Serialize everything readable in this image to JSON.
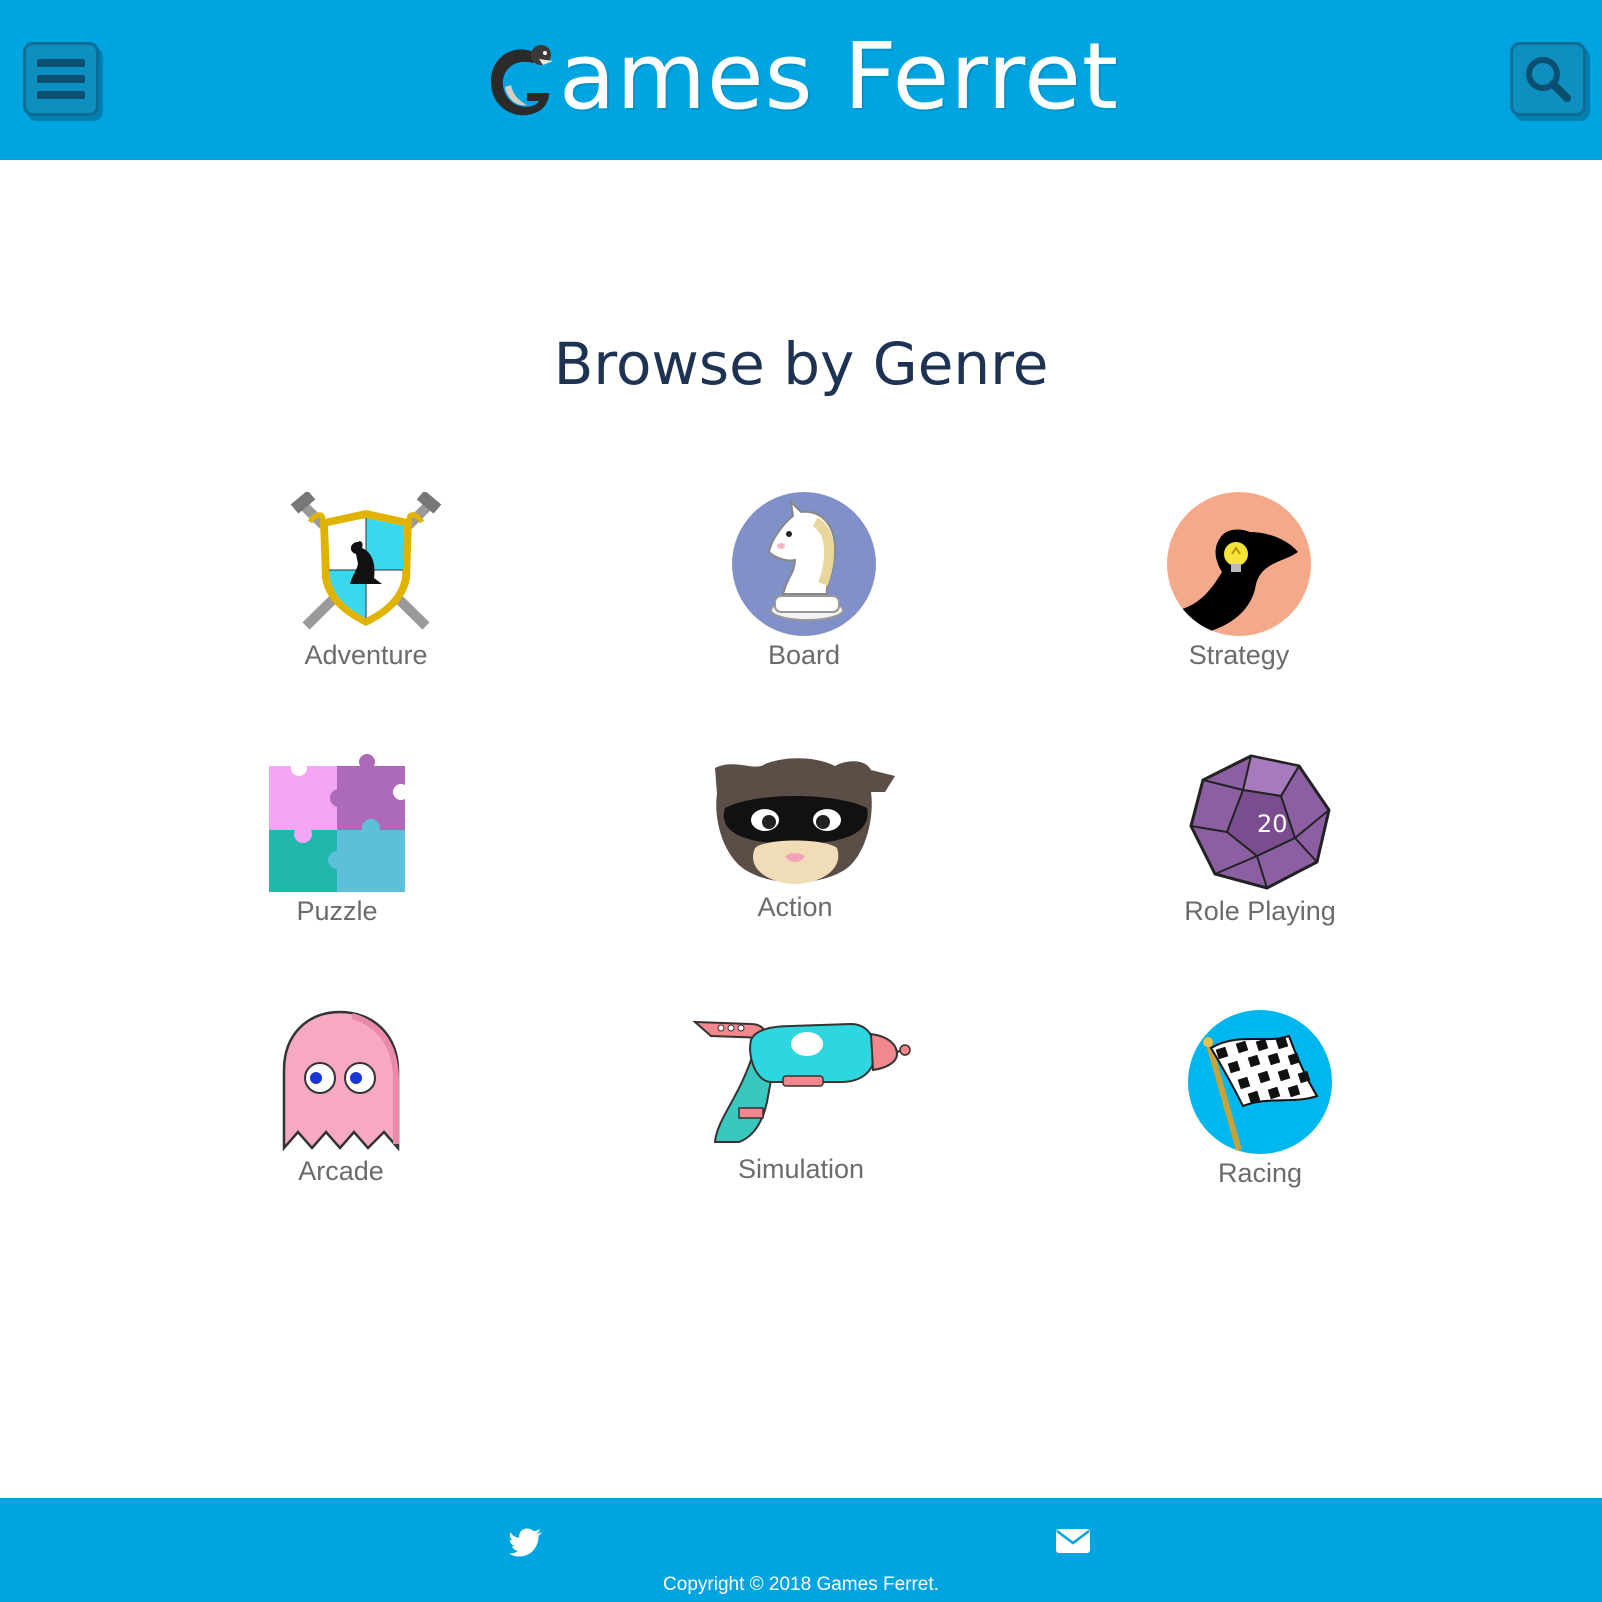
{
  "header": {
    "logo_text": "ames Ferret",
    "logo_letter": "G",
    "menu_icon": "hamburger-menu-icon",
    "search_icon": "search-icon",
    "background_color": "#00a4e0"
  },
  "main": {
    "title": "Browse by Genre",
    "genres": [
      {
        "label": "Adventure",
        "icon": "shield-swords-icon"
      },
      {
        "label": "Board",
        "icon": "chess-knight-icon"
      },
      {
        "label": "Strategy",
        "icon": "ferret-lightbulb-icon"
      },
      {
        "label": "Puzzle",
        "icon": "puzzle-pieces-icon"
      },
      {
        "label": "Action",
        "icon": "masked-ferret-icon"
      },
      {
        "label": "Role Playing",
        "icon": "d20-dice-icon"
      },
      {
        "label": "Arcade",
        "icon": "ghost-icon"
      },
      {
        "label": "Simulation",
        "icon": "ray-gun-icon"
      },
      {
        "label": "Racing",
        "icon": "checkered-flag-icon"
      }
    ]
  },
  "footer": {
    "twitter_icon": "twitter-icon",
    "mail_icon": "mail-icon",
    "copyright": "Copyright © 2018 Games Ferret."
  }
}
